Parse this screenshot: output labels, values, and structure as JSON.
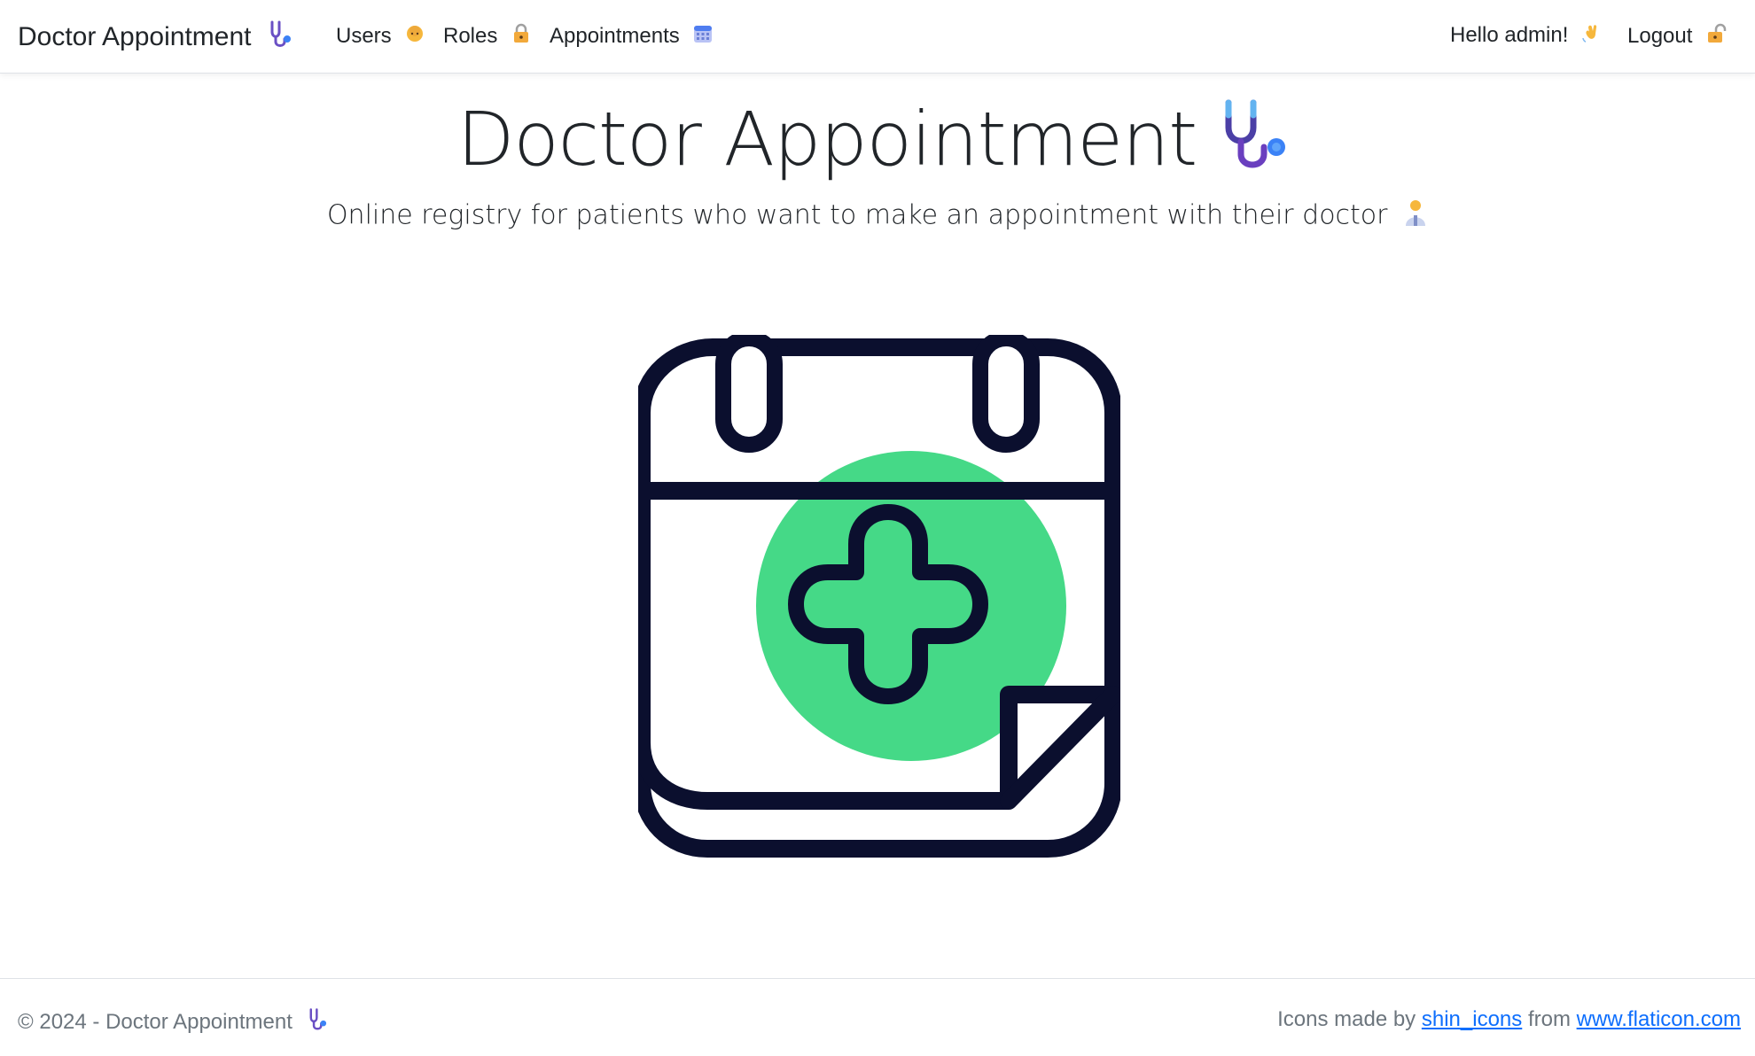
{
  "navbar": {
    "brand": "Doctor Appointment",
    "brand_icon": "stethoscope-icon",
    "links": [
      {
        "label": "Users",
        "icon": "person-icon"
      },
      {
        "label": "Roles",
        "icon": "lock-icon"
      },
      {
        "label": "Appointments",
        "icon": "calendar-icon"
      }
    ],
    "greeting": "Hello admin!",
    "greeting_icon": "waving-hand-icon",
    "logout": "Logout",
    "logout_icon": "unlock-icon"
  },
  "hero": {
    "title": "Doctor Appointment",
    "subtitle": "Online registry for patients who want to make an appointment with their doctor",
    "subtitle_icon": "doctor-icon",
    "illustration": "calendar-medical-cross-icon"
  },
  "footer": {
    "copyright": "© 2024 - Doctor Appointment",
    "credit_prefix": "Icons made by",
    "credit_author": "shin_icons",
    "credit_middle": "from",
    "credit_site": "www.flaticon.com"
  },
  "colors": {
    "accent_green": "#45d987",
    "outline_navy": "#0b0f2e",
    "link_blue": "#0d6efd",
    "muted_text": "#6c757d"
  }
}
